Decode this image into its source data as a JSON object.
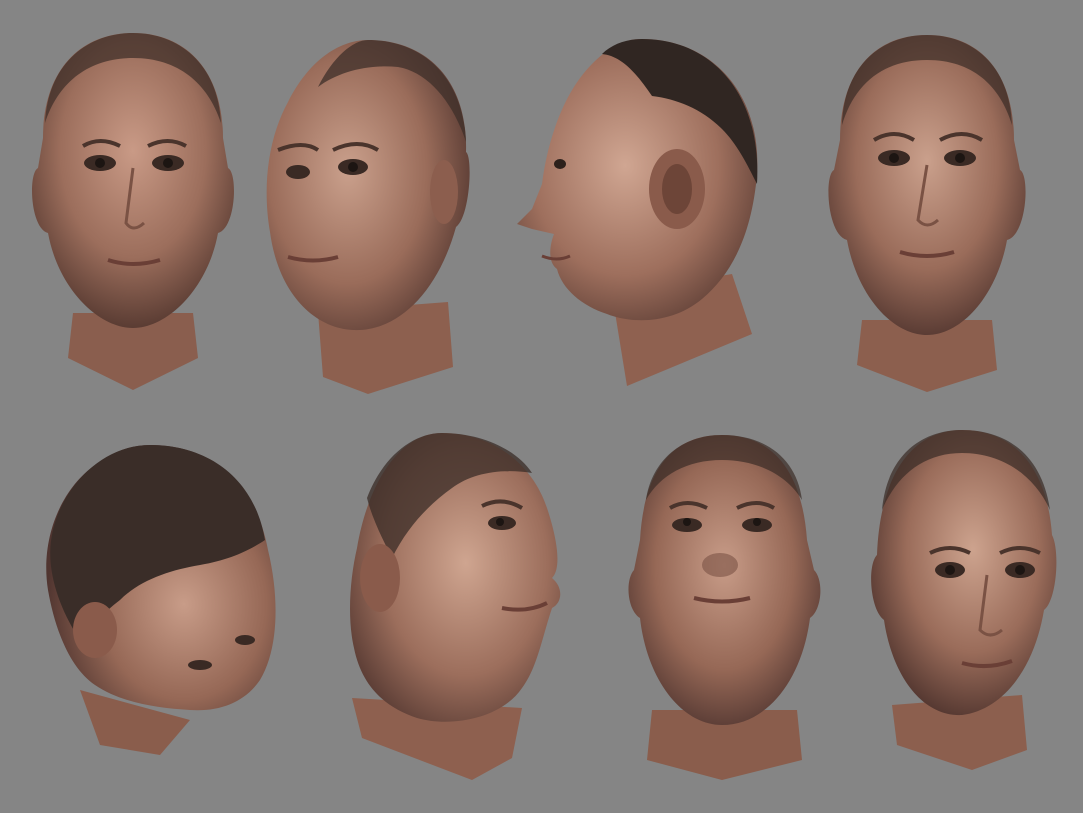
{
  "scene": {
    "background_color": "#858585",
    "skin_light": "#c99a86",
    "skin_mid": "#9c6e5c",
    "skin_dark": "#5a3c33",
    "hair_color": "#2f2522",
    "views": [
      {
        "view": "front"
      },
      {
        "view": "three-quarter-left"
      },
      {
        "view": "profile-left"
      },
      {
        "view": "front-slight"
      },
      {
        "view": "top-down-tilt"
      },
      {
        "view": "looking-up-right"
      },
      {
        "view": "looking-up-front"
      },
      {
        "view": "front-tilt"
      }
    ]
  }
}
